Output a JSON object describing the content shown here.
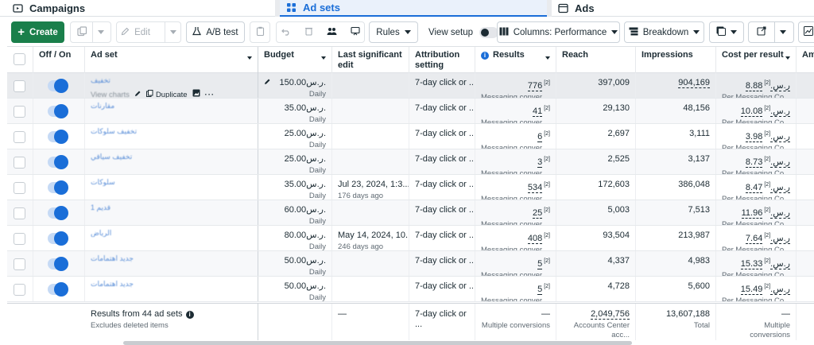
{
  "tabs": {
    "campaigns": "Campaigns",
    "adsets": "Ad sets",
    "ads": "Ads"
  },
  "toolbar": {
    "create": "Create",
    "edit": "Edit",
    "ab_test": "A/B test",
    "rules": "Rules",
    "view_setup": "View setup",
    "columns": "Columns: Performance",
    "breakdown": "Breakdown"
  },
  "colors": {
    "accent": "#1a6ed8",
    "create_green": "#1a7f4b",
    "highlight_row": "#e9ebee"
  },
  "headers": {
    "off_on": "Off / On",
    "ad_set": "Ad set",
    "budget": "Budget",
    "last_edit": "Last significant edit",
    "attribution": "Attribution setting",
    "results": "Results",
    "reach": "Reach",
    "impressions": "Impressions",
    "cpr": "Cost per result",
    "amount_cut": "Am"
  },
  "row_tools": {
    "view_charts": "View charts",
    "duplicate": "Duplicate"
  },
  "rows": [
    {
      "name": "تخفيف",
      "budget": "150.00ر.س.",
      "budget_type": "Daily",
      "edit": "",
      "edit_sub": "",
      "attribution": "7-day click or ...",
      "results": "776",
      "results_sup": "[2]",
      "results_sub": "Messaging conver...",
      "reach": "397,009",
      "impressions": "904,169",
      "cpr": "8.88ر.س.",
      "cpr_sup": "[2]",
      "cpr_sub": "Per Messaging Co..."
    },
    {
      "name": "مقارنات",
      "budget": "35.00ر.س.",
      "budget_type": "Daily",
      "edit": "",
      "edit_sub": "",
      "attribution": "7-day click or ...",
      "results": "41",
      "results_sup": "[2]",
      "results_sub": "Messaging conver...",
      "reach": "29,130",
      "impressions": "48,156",
      "cpr": "10.08ر.س.",
      "cpr_sup": "[2]",
      "cpr_sub": "Per Messaging Co..."
    },
    {
      "name": "تخفيف سلوكات",
      "budget": "25.00ر.س.",
      "budget_type": "Daily",
      "edit": "",
      "edit_sub": "",
      "attribution": "7-day click or ...",
      "results": "6",
      "results_sup": "[2]",
      "results_sub": "Messaging conver...",
      "reach": "2,697",
      "impressions": "3,111",
      "cpr": "3.98ر.س.",
      "cpr_sup": "[2]",
      "cpr_sub": "Per Messaging Co..."
    },
    {
      "name": "تخفيف سياقي",
      "budget": "25.00ر.س.",
      "budget_type": "Daily",
      "edit": "",
      "edit_sub": "",
      "attribution": "7-day click or ...",
      "results": "3",
      "results_sup": "[2]",
      "results_sub": "Messaging conver...",
      "reach": "2,525",
      "impressions": "3,137",
      "cpr": "8.73ر.س.",
      "cpr_sup": "[2]",
      "cpr_sub": "Per Messaging Co..."
    },
    {
      "name": "سلوكات",
      "budget": "35.00ر.س.",
      "budget_type": "Daily",
      "edit": "Jul 23, 2024, 1:3...",
      "edit_sub": "176 days ago",
      "attribution": "7-day click or ...",
      "results": "534",
      "results_sup": "[2]",
      "results_sub": "Messaging conver...",
      "reach": "172,603",
      "impressions": "386,048",
      "cpr": "8.47ر.س.",
      "cpr_sup": "[2]",
      "cpr_sub": "Per Messaging Co..."
    },
    {
      "name": "قديم 1",
      "budget": "60.00ر.س.",
      "budget_type": "Daily",
      "edit": "",
      "edit_sub": "",
      "attribution": "7-day click or ...",
      "results": "25",
      "results_sup": "[2]",
      "results_sub": "Messaging conver...",
      "reach": "5,003",
      "impressions": "7,513",
      "cpr": "11.96ر.س.",
      "cpr_sup": "[2]",
      "cpr_sub": "Per Messaging Co..."
    },
    {
      "name": "الرياض",
      "budget": "80.00ر.س.",
      "budget_type": "Daily",
      "edit": "May 14, 2024, 10...",
      "edit_sub": "246 days ago",
      "attribution": "7-day click or ...",
      "results": "408",
      "results_sup": "[2]",
      "results_sub": "Messaging conver...",
      "reach": "93,504",
      "impressions": "213,987",
      "cpr": "7.64ر.س.",
      "cpr_sup": "[2]",
      "cpr_sub": "Per Messaging Co..."
    },
    {
      "name": "جديد اهتمامات",
      "budget": "50.00ر.س.",
      "budget_type": "Daily",
      "edit": "",
      "edit_sub": "",
      "attribution": "7-day click or ...",
      "results": "5",
      "results_sup": "[2]",
      "results_sub": "Messaging conver...",
      "reach": "4,337",
      "impressions": "4,983",
      "cpr": "15.33ر.س.",
      "cpr_sup": "[2]",
      "cpr_sub": "Per Messaging Co..."
    },
    {
      "name": "جديد اهتمامات",
      "budget": "50.00ر.س.",
      "budget_type": "Daily",
      "edit": "",
      "edit_sub": "",
      "attribution": "7-day click or ...",
      "results": "5",
      "results_sup": "[2]",
      "results_sub": "Messaging conver...",
      "reach": "4,728",
      "impressions": "5,600",
      "cpr": "15.49ر.س.",
      "cpr_sup": "[2]",
      "cpr_sub": "Per Messaging Co..."
    }
  ],
  "footer": {
    "title": "Results from 44 ad sets",
    "subtitle": "Excludes deleted items",
    "last_edit": "—",
    "attribution": "7-day click or ...",
    "results": "—",
    "results_sub": "Multiple conversions",
    "reach": "2,049,756",
    "reach_sub": "Accounts Center acc...",
    "impressions": "13,607,188",
    "impressions_sub": "Total",
    "cpr": "—",
    "cpr_sub": "Multiple conversions"
  }
}
